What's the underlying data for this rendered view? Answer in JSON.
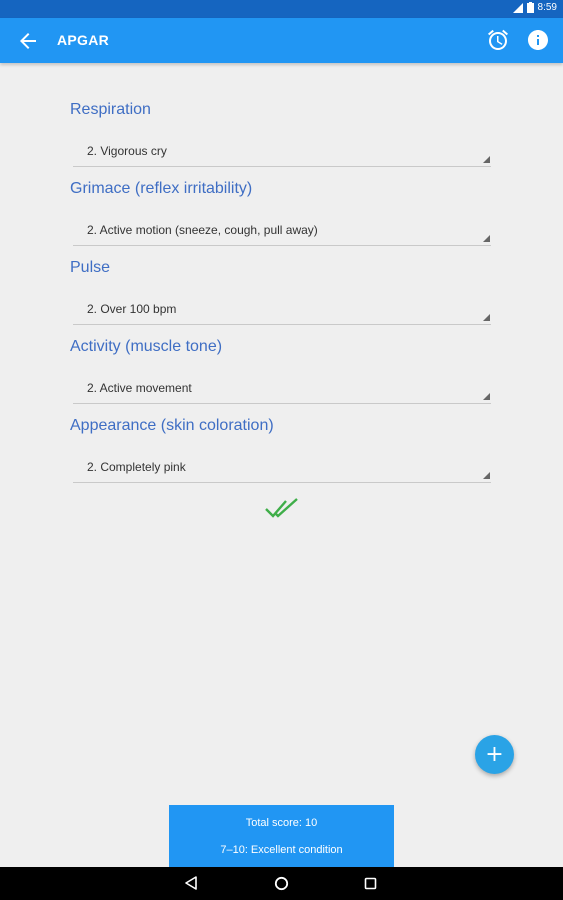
{
  "status_bar": {
    "time": "8:59"
  },
  "app_bar": {
    "title": "APGAR"
  },
  "fields": [
    {
      "label": "Respiration",
      "value": "2. Vigorous cry"
    },
    {
      "label": "Grimace (reflex irritability)",
      "value": "2. Active motion (sneeze, cough, pull away)"
    },
    {
      "label": "Pulse",
      "value": "2. Over 100 bpm"
    },
    {
      "label": "Activity (muscle tone)",
      "value": "2. Active movement"
    },
    {
      "label": "Appearance (skin coloration)",
      "value": "2. Completely pink"
    }
  ],
  "fab": {
    "label": "+"
  },
  "score": {
    "total_label": "Total score:  10",
    "interpretation": "7–10: Excellent condition"
  },
  "colors": {
    "app_bar": "#2196f3",
    "status_bar": "#1565c0",
    "label_text": "#3f6ec4",
    "check": "#3fae49"
  },
  "icons": [
    "arrow-back-icon",
    "alarm-icon",
    "info-icon",
    "double-check-icon",
    "plus-icon",
    "nav-back-icon",
    "nav-home-icon",
    "nav-recents-icon"
  ]
}
